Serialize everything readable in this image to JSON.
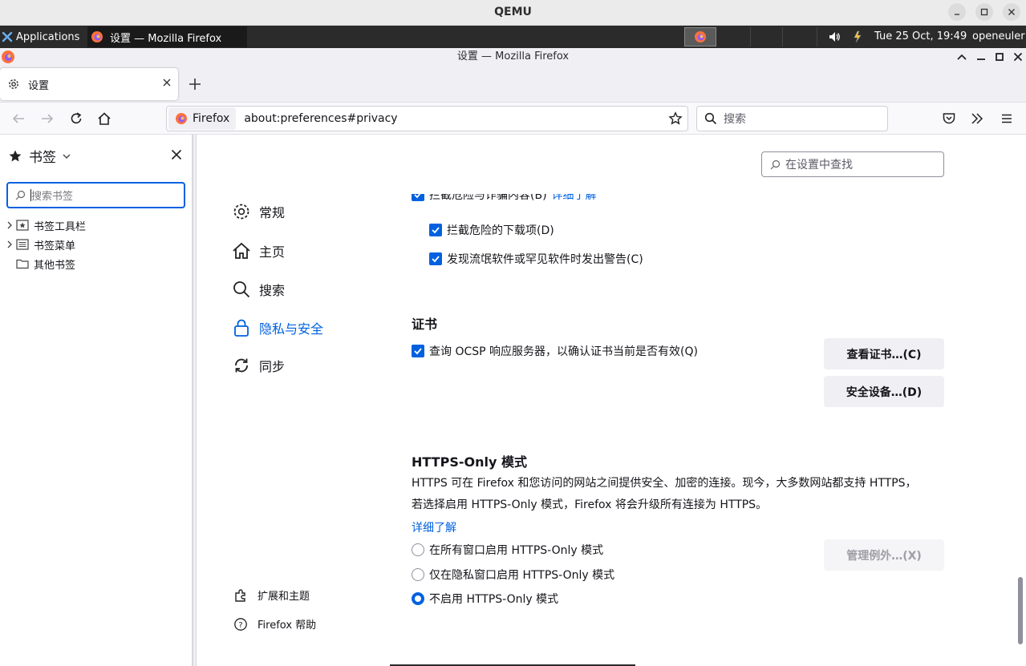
{
  "qemu": {
    "title": "QEMU"
  },
  "taskbar": {
    "applications_label": "Applications",
    "window_task_label": "设置 — Mozilla Firefox",
    "clock": "Tue 25 Oct, 19:49",
    "user": "openeuler"
  },
  "window": {
    "title": "设置 — Mozilla Firefox"
  },
  "tab": {
    "label": "设置"
  },
  "navbar": {
    "identity_label": "Firefox",
    "url": "about:preferences#privacy",
    "search_placeholder": "搜索"
  },
  "sidebar": {
    "title": "书签",
    "search_placeholder": "搜索书签",
    "items": [
      {
        "label": "书签工具栏"
      },
      {
        "label": "书签菜单"
      },
      {
        "label": "其他书签"
      }
    ]
  },
  "prefs": {
    "find_placeholder": "在设置中查找",
    "categories": [
      {
        "label": "常规"
      },
      {
        "label": "主页"
      },
      {
        "label": "搜索"
      },
      {
        "label": "隐私与安全"
      },
      {
        "label": "同步"
      }
    ],
    "footer": {
      "extensions_label": "扩展和主题",
      "help_label": "Firefox 帮助"
    },
    "partial_option_label": "拦截危险与诈骗内容(B)",
    "partial_link": "详细了解",
    "block_downloads_label": "拦截危险的下载项(D)",
    "warn_unwanted_label": "发现流氓软件或罕见软件时发出警告(C)",
    "certificates": {
      "title": "证书",
      "ocsp_label": "查询 OCSP 响应服务器，以确认证书当前是否有效(Q)",
      "view_button": "查看证书…(C)",
      "devices_button": "安全设备…(D)"
    },
    "https_only": {
      "title": "HTTPS-Only 模式",
      "description_line1": "HTTPS 可在 Firefox 和您访问的网站之间提供安全、加密的连接。现今，大多数网站都支持 HTTPS，",
      "description_line2": "若选择启用 HTTPS-Only 模式，Firefox 将会升级所有连接为 HTTPS。",
      "learn_more": "详细了解",
      "options": [
        {
          "label": "在所有窗口启用 HTTPS-Only 模式",
          "selected": false
        },
        {
          "label": "仅在隐私窗口启用 HTTPS-Only 模式",
          "selected": false
        },
        {
          "label": "不启用 HTTPS-Only 模式",
          "selected": true
        }
      ],
      "exceptions_button": "管理例外…(X)"
    }
  },
  "colors": {
    "accent": "#0061e0",
    "taskbar": "#2b2b2b"
  }
}
